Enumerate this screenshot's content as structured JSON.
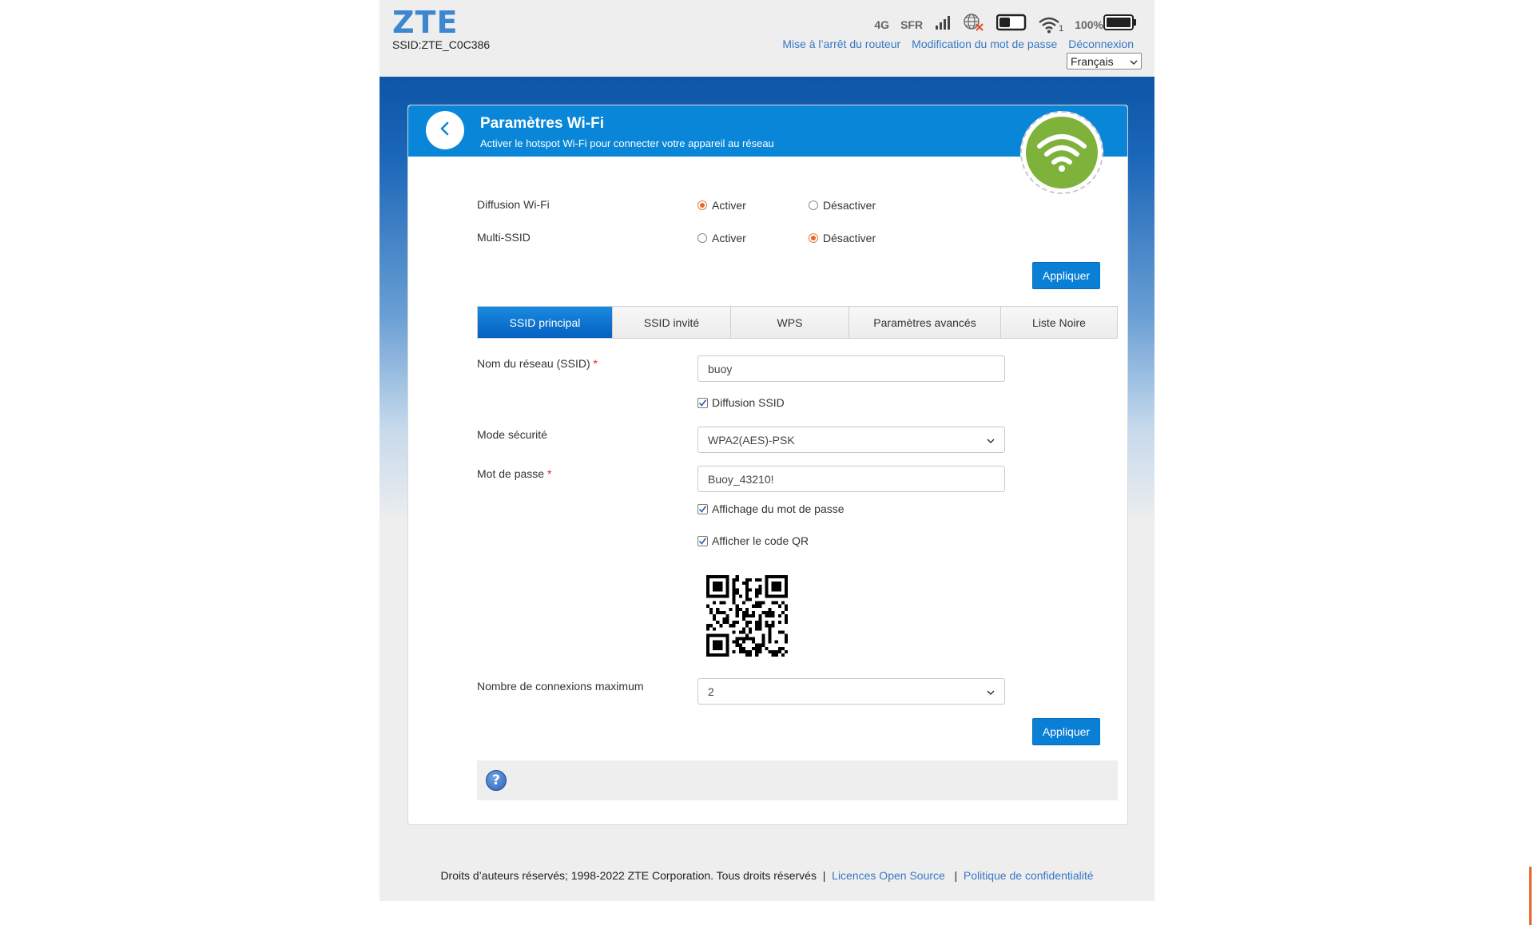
{
  "header": {
    "logo": "ZTE",
    "ssid": "SSID:ZTE_C0C386",
    "network_type": "4G",
    "carrier": "SFR",
    "wifi_clients": "1",
    "battery": "100%",
    "links": {
      "shutdown": "Mise à l’arrêt du routeur",
      "change_password": "Modification du mot de passe",
      "logout": "Déconnexion"
    },
    "language": "Français"
  },
  "page": {
    "title": "Paramètres Wi-Fi",
    "subtitle": "Activer le hotspot Wi-Fi pour connecter votre appareil au réseau"
  },
  "wifi_broadcast": {
    "label": "Diffusion Wi-Fi",
    "enable": "Activer",
    "disable": "Désactiver",
    "selected": "enable"
  },
  "multi_ssid": {
    "label": "Multi-SSID",
    "enable": "Activer",
    "disable": "Désactiver",
    "selected": "disable"
  },
  "apply_label": "Appliquer",
  "tabs": [
    "SSID principal",
    "SSID invité",
    "WPS",
    "Paramètres avancés",
    "Liste Noire"
  ],
  "active_tab": 0,
  "form": {
    "ssid_label": "Nom du réseau (SSID)",
    "ssid_value": "buoy",
    "broadcast_ssid_label": "Diffusion SSID",
    "broadcast_ssid_checked": true,
    "security_label": "Mode sécurité",
    "security_value": "WPA2(AES)-PSK",
    "password_label": "Mot de passe",
    "password_value": "Buoy_43210!",
    "show_password_label": "Affichage du mot de passe",
    "show_password_checked": true,
    "show_qr_label": "Afficher le code QR",
    "show_qr_checked": true,
    "max_conn_label": "Nombre de connexions maximum",
    "max_conn_value": "2",
    "required_mark": "*"
  },
  "footer": {
    "copyright": "Droits d’auteurs réservés; 1998-2022 ZTE Corporation. Tous droits réservés",
    "separator": "|",
    "open_source": "Licences Open Source",
    "privacy": "Politique de confidentialité"
  },
  "colors": {
    "brand_blue": "#0a86d8",
    "accent_orange": "#e8662a",
    "wifi_green": "#7fb23a"
  }
}
